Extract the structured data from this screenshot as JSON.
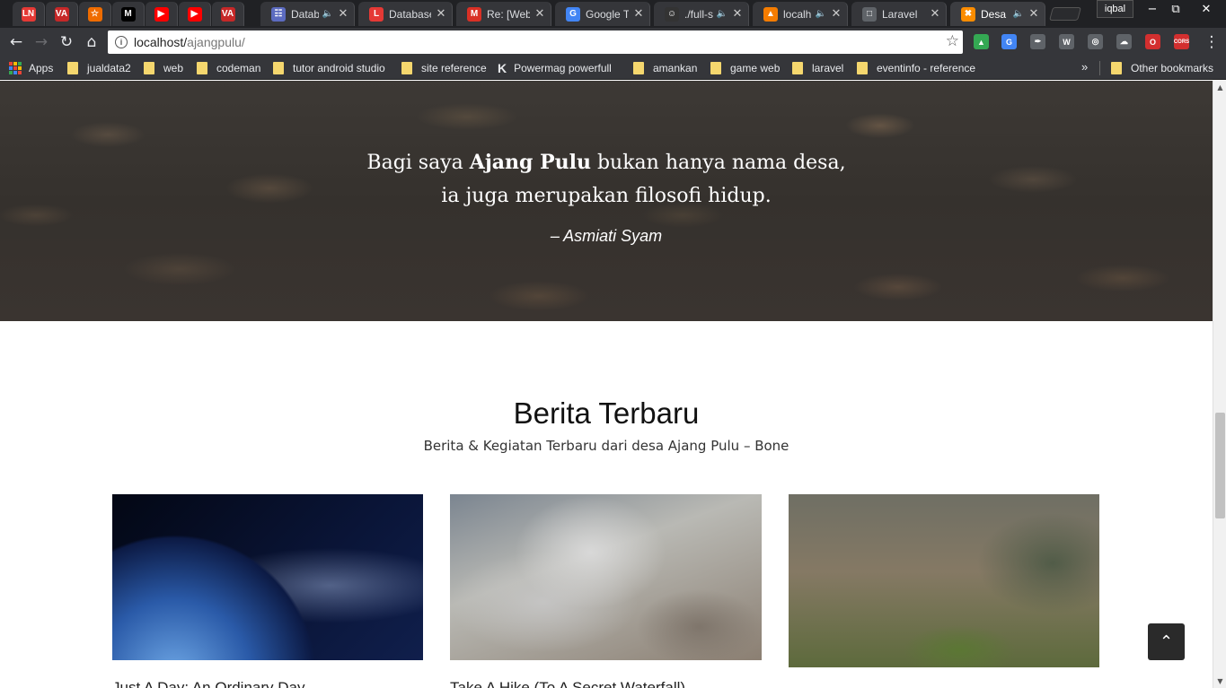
{
  "tabs": [
    {
      "title": "",
      "favicon": "LN",
      "color": "#e53935",
      "pinned": true
    },
    {
      "title": "",
      "favicon": "VA",
      "color": "#c62828",
      "pinned": true
    },
    {
      "title": "",
      "favicon": "☆",
      "color": "#ef6c00",
      "pinned": true
    },
    {
      "title": "",
      "favicon": "M",
      "color": "#000000",
      "pinned": true
    },
    {
      "title": "",
      "favicon": "▶",
      "color": "#ff0000",
      "pinned": true
    },
    {
      "title": "",
      "favicon": "▶",
      "color": "#ff0000",
      "pinned": true
    },
    {
      "title": "",
      "favicon": "VA",
      "color": "#c62828",
      "pinned": true
    },
    {
      "title": "Datab",
      "favicon": "☷",
      "color": "#5c6bc0",
      "audio": true
    },
    {
      "title": "Database",
      "favicon": "L",
      "color": "#e53935"
    },
    {
      "title": "Re: [Web",
      "favicon": "M",
      "color": "#d93025"
    },
    {
      "title": "Google T",
      "favicon": "G",
      "color": "#4285f4"
    },
    {
      "title": "./full-s",
      "favicon": "☺",
      "color": "#333333",
      "audio": true
    },
    {
      "title": "localh",
      "favicon": "▲",
      "color": "#f57c00",
      "audio": true
    },
    {
      "title": "Laravel",
      "favicon": "□",
      "color": "#5f6368"
    },
    {
      "title": "Desa",
      "favicon": "✖",
      "color": "#fb8c00",
      "audio": true,
      "active": true
    }
  ],
  "profile_name": "iqbal",
  "window_controls": {
    "minimize": "−",
    "restore": "⧉",
    "close": "✕"
  },
  "toolbar": {
    "back": "←",
    "forward": "→",
    "reload": "↻",
    "home": "⌂",
    "url_host": "localhost/",
    "url_path": "ajangpulu/",
    "star": "☆",
    "menu": "⋮"
  },
  "extensions": [
    {
      "name": "google-drive-icon",
      "glyph": "▲",
      "color": "#34a853"
    },
    {
      "name": "google-translate-icon",
      "glyph": "G",
      "color": "#4285f4"
    },
    {
      "name": "color-picker-icon",
      "glyph": "✒",
      "color": "#5f6368"
    },
    {
      "name": "wordpress-icon",
      "glyph": "W",
      "color": "#5f6368"
    },
    {
      "name": "globe-icon",
      "glyph": "◎",
      "color": "#5f6368"
    },
    {
      "name": "cloud-icon",
      "glyph": "☁",
      "color": "#5f6368"
    },
    {
      "name": "opera-icon",
      "glyph": "O",
      "color": "#d32f2f"
    },
    {
      "name": "cors-icon",
      "glyph": "CORS",
      "color": "#d32f2f"
    }
  ],
  "bookmarks": {
    "apps_label": "Apps",
    "items": [
      {
        "label": "jualdata2",
        "type": "folder"
      },
      {
        "label": "web",
        "type": "folder"
      },
      {
        "label": "codeman",
        "type": "folder"
      },
      {
        "label": "tutor android studio",
        "type": "folder"
      },
      {
        "label": "site reference",
        "type": "folder"
      },
      {
        "label": "Powermag powerfull",
        "type": "link",
        "icon": "K"
      },
      {
        "label": "amankan",
        "type": "folder"
      },
      {
        "label": "game web",
        "type": "folder"
      },
      {
        "label": "laravel",
        "type": "folder"
      },
      {
        "label": "eventinfo - reference",
        "type": "folder"
      }
    ],
    "overflow": "»",
    "other_label": "Other bookmarks"
  },
  "hero": {
    "quote_line1_pre": "Bagi saya ",
    "quote_line1_bold": "Ajang Pulu",
    "quote_line1_post": " bukan hanya nama desa,",
    "quote_line2": "ia juga merupakan filosofi hidup.",
    "author": "– Asmiati Syam"
  },
  "news": {
    "title": "Berita Terbaru",
    "subtitle": "Berita & Kegiatan Terbaru dari desa Ajang Pulu – Bone",
    "cards": [
      {
        "title": "Just A Day: An Ordinary Day"
      },
      {
        "title": "Take A Hike (To A Secret Waterfall)"
      },
      {
        "title": ""
      }
    ]
  },
  "back_to_top": "⌃"
}
